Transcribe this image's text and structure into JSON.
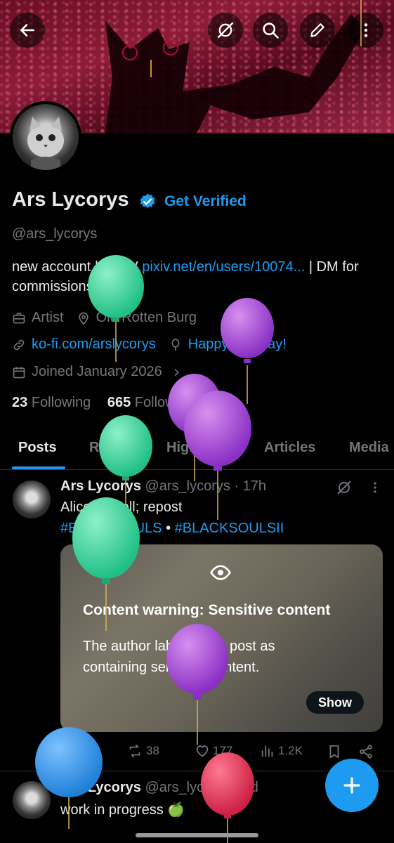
{
  "profile": {
    "name": "Ars Lycorys",
    "get_verified": "Get Verified",
    "handle": "@ars_lycorys",
    "bio_prefix": "new account | PIXIV ",
    "bio_link": "pixiv.net/en/users/10074...",
    "bio_suffix": " | DM for commissions!",
    "category": "Artist",
    "location": "Old Rotten Burg",
    "website": "ko-fi.com/arslycorys",
    "birthday": "Happy birthday!",
    "joined": "Joined January 2026",
    "following_count": "23",
    "following_label": "Following",
    "followers_count": "665",
    "followers_label": "Followers"
  },
  "tabs": [
    "Posts",
    "Replies",
    "Highlights",
    "Articles",
    "Media"
  ],
  "posts": [
    {
      "author": "Ars Lycorys",
      "handle": "@ars_lycorys",
      "time": "· 17h",
      "text": "Alice Liddell; repost",
      "hashtag1": "#BLACKSOULS",
      "sep": " • ",
      "hashtag2": "#BLACKSOULSII",
      "warning_title": "Content warning: Sensitive content",
      "warning_body": "The author labeled this post as containing sensitive content.",
      "show_label": "Show",
      "replies": "2",
      "reposts": "38",
      "likes": "177",
      "views": "1.2K"
    },
    {
      "author": "Ars Lycorys",
      "handle": "@ars_lycorys",
      "time": "· 3d",
      "text": "work in progress 🍏"
    }
  ],
  "colors": {
    "accent": "#1d9bf0",
    "background": "#000000",
    "muted": "#71767b",
    "text": "#e7e9ea"
  }
}
